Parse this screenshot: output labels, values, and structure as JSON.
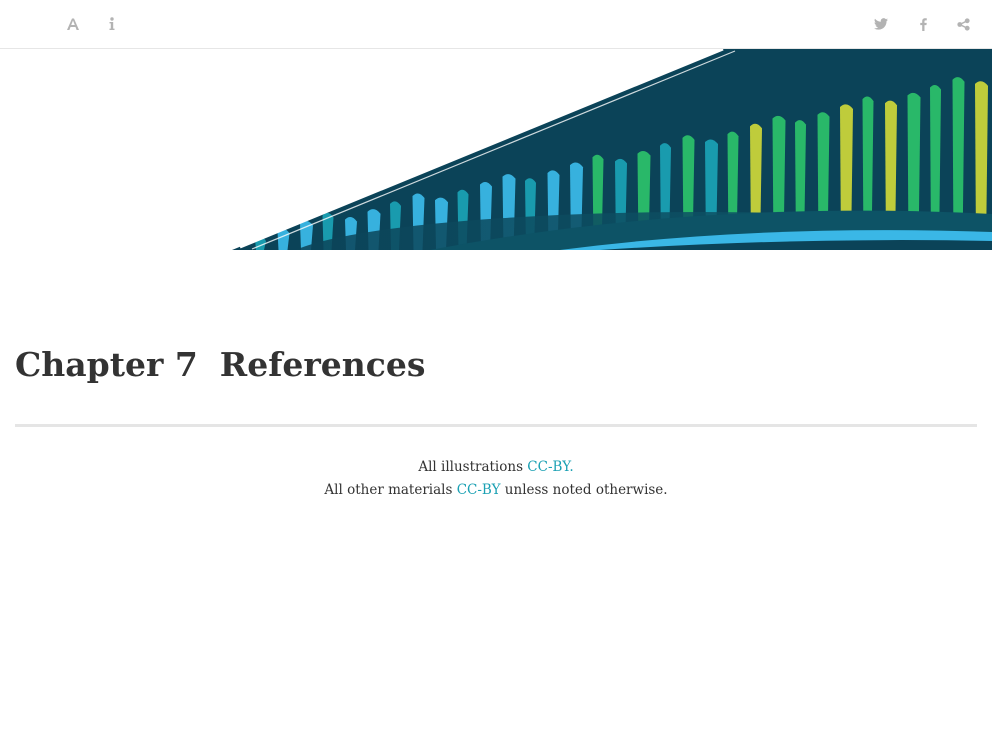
{
  "toolbar": {
    "left_icons": [
      "font-settings-icon",
      "info-icon"
    ],
    "right_icons": [
      "twitter-icon",
      "facebook-icon",
      "share-icon"
    ],
    "icon_color": "#b3b3b3"
  },
  "banner": {
    "colors": {
      "navy": "#0b4358",
      "teal": "#1aa0b3",
      "light_blue": "#3ab7e6",
      "green": "#2bbf6a",
      "lime": "#c9d43a"
    }
  },
  "chapter": {
    "number": "Chapter 7",
    "title": "References"
  },
  "credits": {
    "line1_prefix": "All illustrations ",
    "line1_link": "CC-BY.",
    "line2_prefix": "All other materials ",
    "line2_link": "CC-BY",
    "line2_suffix": " unless noted otherwise."
  },
  "colors": {
    "link": "#1aa0b3",
    "text": "#333333",
    "rule": "#e5e5e5"
  }
}
